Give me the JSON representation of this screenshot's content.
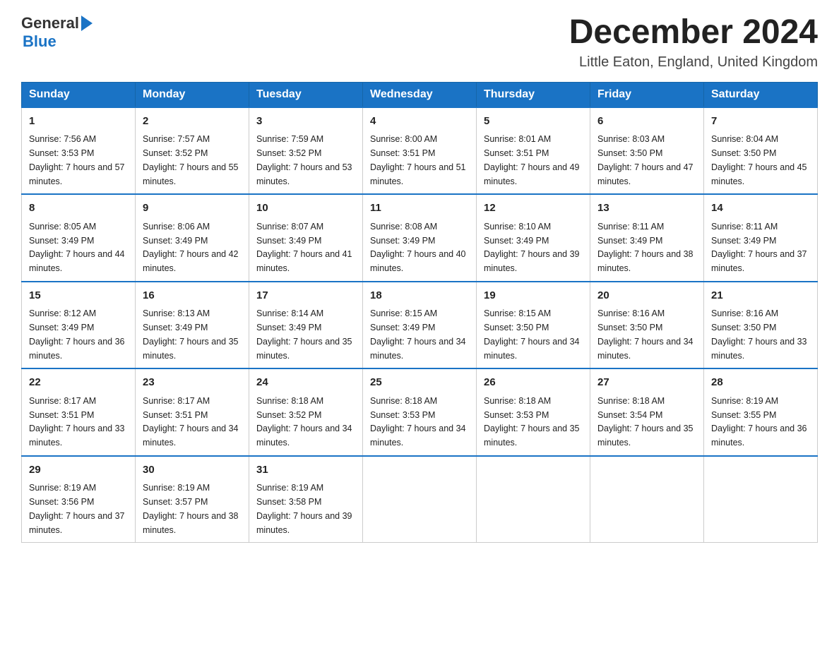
{
  "header": {
    "logo_general": "General",
    "logo_blue": "Blue",
    "month_title": "December 2024",
    "location": "Little Eaton, England, United Kingdom"
  },
  "days_of_week": [
    "Sunday",
    "Monday",
    "Tuesday",
    "Wednesday",
    "Thursday",
    "Friday",
    "Saturday"
  ],
  "weeks": [
    [
      {
        "day": "1",
        "sunrise": "7:56 AM",
        "sunset": "3:53 PM",
        "daylight": "7 hours and 57 minutes."
      },
      {
        "day": "2",
        "sunrise": "7:57 AM",
        "sunset": "3:52 PM",
        "daylight": "7 hours and 55 minutes."
      },
      {
        "day": "3",
        "sunrise": "7:59 AM",
        "sunset": "3:52 PM",
        "daylight": "7 hours and 53 minutes."
      },
      {
        "day": "4",
        "sunrise": "8:00 AM",
        "sunset": "3:51 PM",
        "daylight": "7 hours and 51 minutes."
      },
      {
        "day": "5",
        "sunrise": "8:01 AM",
        "sunset": "3:51 PM",
        "daylight": "7 hours and 49 minutes."
      },
      {
        "day": "6",
        "sunrise": "8:03 AM",
        "sunset": "3:50 PM",
        "daylight": "7 hours and 47 minutes."
      },
      {
        "day": "7",
        "sunrise": "8:04 AM",
        "sunset": "3:50 PM",
        "daylight": "7 hours and 45 minutes."
      }
    ],
    [
      {
        "day": "8",
        "sunrise": "8:05 AM",
        "sunset": "3:49 PM",
        "daylight": "7 hours and 44 minutes."
      },
      {
        "day": "9",
        "sunrise": "8:06 AM",
        "sunset": "3:49 PM",
        "daylight": "7 hours and 42 minutes."
      },
      {
        "day": "10",
        "sunrise": "8:07 AM",
        "sunset": "3:49 PM",
        "daylight": "7 hours and 41 minutes."
      },
      {
        "day": "11",
        "sunrise": "8:08 AM",
        "sunset": "3:49 PM",
        "daylight": "7 hours and 40 minutes."
      },
      {
        "day": "12",
        "sunrise": "8:10 AM",
        "sunset": "3:49 PM",
        "daylight": "7 hours and 39 minutes."
      },
      {
        "day": "13",
        "sunrise": "8:11 AM",
        "sunset": "3:49 PM",
        "daylight": "7 hours and 38 minutes."
      },
      {
        "day": "14",
        "sunrise": "8:11 AM",
        "sunset": "3:49 PM",
        "daylight": "7 hours and 37 minutes."
      }
    ],
    [
      {
        "day": "15",
        "sunrise": "8:12 AM",
        "sunset": "3:49 PM",
        "daylight": "7 hours and 36 minutes."
      },
      {
        "day": "16",
        "sunrise": "8:13 AM",
        "sunset": "3:49 PM",
        "daylight": "7 hours and 35 minutes."
      },
      {
        "day": "17",
        "sunrise": "8:14 AM",
        "sunset": "3:49 PM",
        "daylight": "7 hours and 35 minutes."
      },
      {
        "day": "18",
        "sunrise": "8:15 AM",
        "sunset": "3:49 PM",
        "daylight": "7 hours and 34 minutes."
      },
      {
        "day": "19",
        "sunrise": "8:15 AM",
        "sunset": "3:50 PM",
        "daylight": "7 hours and 34 minutes."
      },
      {
        "day": "20",
        "sunrise": "8:16 AM",
        "sunset": "3:50 PM",
        "daylight": "7 hours and 34 minutes."
      },
      {
        "day": "21",
        "sunrise": "8:16 AM",
        "sunset": "3:50 PM",
        "daylight": "7 hours and 33 minutes."
      }
    ],
    [
      {
        "day": "22",
        "sunrise": "8:17 AM",
        "sunset": "3:51 PM",
        "daylight": "7 hours and 33 minutes."
      },
      {
        "day": "23",
        "sunrise": "8:17 AM",
        "sunset": "3:51 PM",
        "daylight": "7 hours and 34 minutes."
      },
      {
        "day": "24",
        "sunrise": "8:18 AM",
        "sunset": "3:52 PM",
        "daylight": "7 hours and 34 minutes."
      },
      {
        "day": "25",
        "sunrise": "8:18 AM",
        "sunset": "3:53 PM",
        "daylight": "7 hours and 34 minutes."
      },
      {
        "day": "26",
        "sunrise": "8:18 AM",
        "sunset": "3:53 PM",
        "daylight": "7 hours and 35 minutes."
      },
      {
        "day": "27",
        "sunrise": "8:18 AM",
        "sunset": "3:54 PM",
        "daylight": "7 hours and 35 minutes."
      },
      {
        "day": "28",
        "sunrise": "8:19 AM",
        "sunset": "3:55 PM",
        "daylight": "7 hours and 36 minutes."
      }
    ],
    [
      {
        "day": "29",
        "sunrise": "8:19 AM",
        "sunset": "3:56 PM",
        "daylight": "7 hours and 37 minutes."
      },
      {
        "day": "30",
        "sunrise": "8:19 AM",
        "sunset": "3:57 PM",
        "daylight": "7 hours and 38 minutes."
      },
      {
        "day": "31",
        "sunrise": "8:19 AM",
        "sunset": "3:58 PM",
        "daylight": "7 hours and 39 minutes."
      },
      null,
      null,
      null,
      null
    ]
  ]
}
